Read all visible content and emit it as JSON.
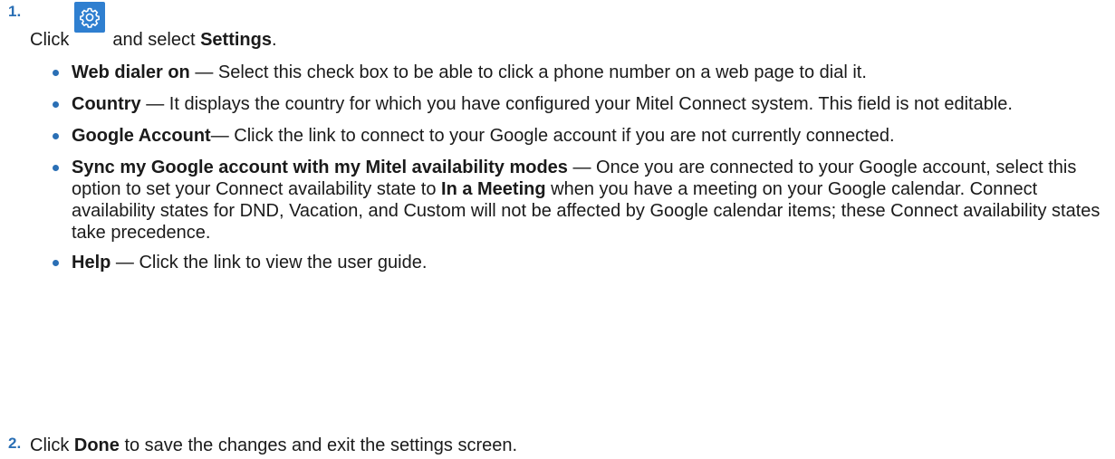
{
  "colors": {
    "accent": "#2a6fb5",
    "gear_bg": "#2f7fd0"
  },
  "step1": {
    "number": "1.",
    "pre": "Click",
    "icon": "gear-icon",
    "mid": "and select",
    "bold": "Settings",
    "end": "."
  },
  "bullets": [
    {
      "term": "Web dialer on",
      "text": " — Select this check box to be able to click a phone number on a web page to dial it."
    },
    {
      "term": "Country",
      "text": " — It displays the country for which you have configured your Mitel Connect system. This field is not editable."
    },
    {
      "term": "Google Account",
      "text": "— Click the link to connect to your Google account if you are not currently connected."
    },
    {
      "term": "Sync my Google account with my Mitel availability modes",
      "text_a": " — Once you are connected to your Google account, select this option to set your Connect availability state to ",
      "bold_mid": "In a Meeting",
      "text_b": " when you have a meeting on your Google calendar. Connect availability states for DND, Vacation, and Custom will not be affected by Google calendar items; these Connect availability states take precedence."
    },
    {
      "term": "Help",
      "text": " — Click the link to view the user guide."
    }
  ],
  "step2": {
    "number": "2.",
    "pre": "Click ",
    "bold": "Done",
    "post": " to save the changes and exit the settings screen."
  }
}
